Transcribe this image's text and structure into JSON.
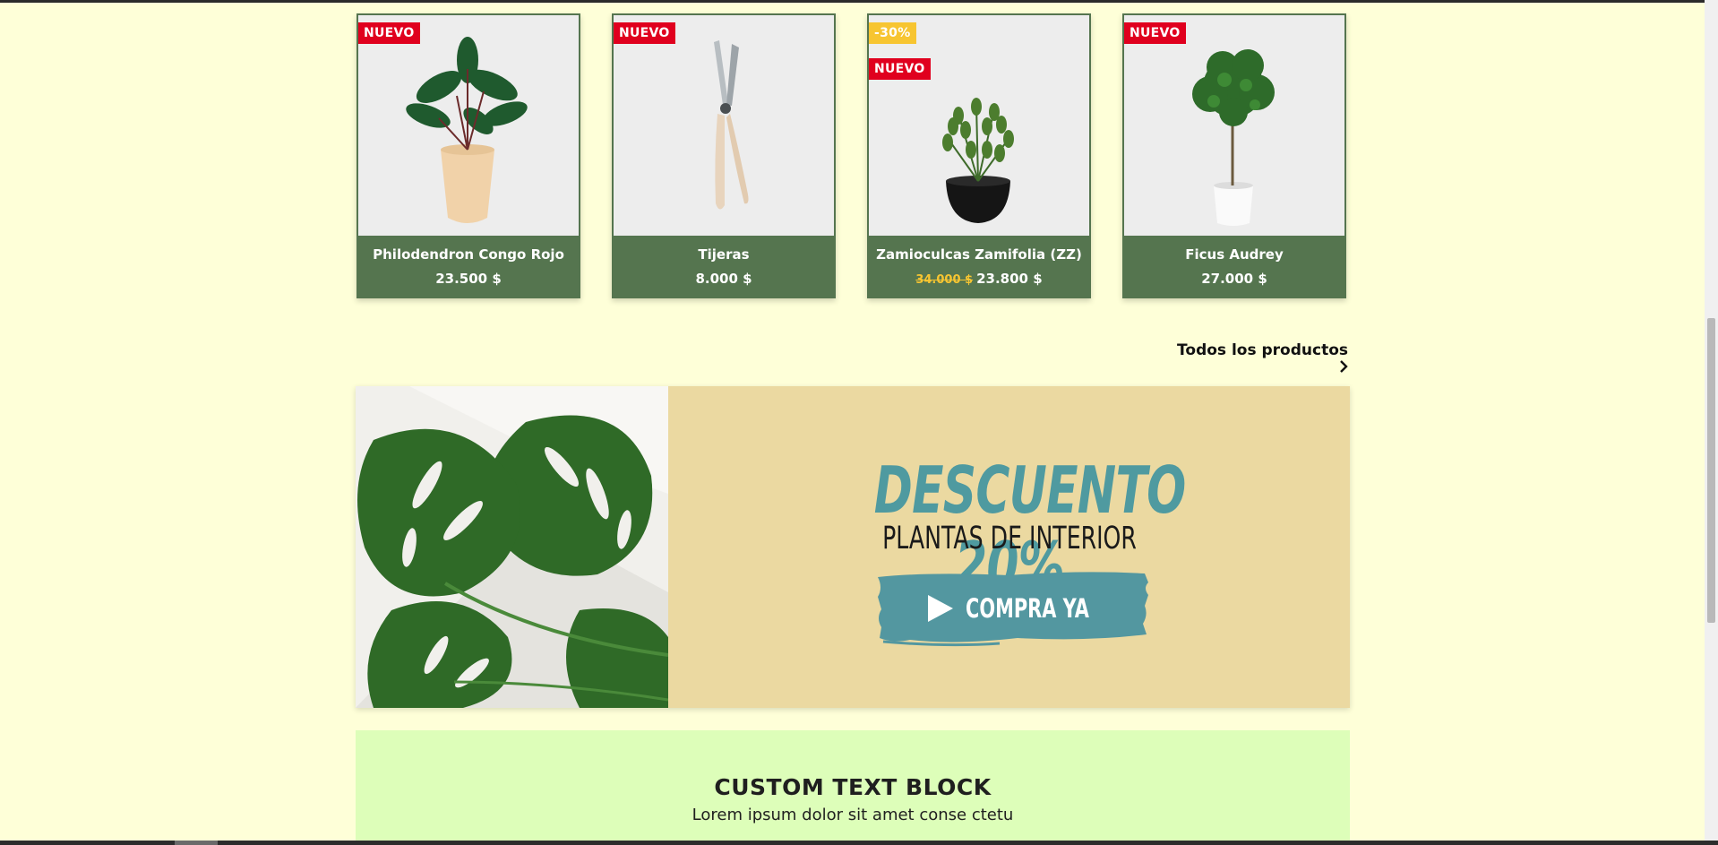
{
  "products": [
    {
      "name": "Philodendron Congo Rojo",
      "price": "23.500 $",
      "badges": [
        "NUEVO"
      ]
    },
    {
      "name": "Tijeras",
      "price": "8.000 $",
      "badges": [
        "NUEVO"
      ]
    },
    {
      "name": "Zamioculcas Zamifolia (ZZ)",
      "old_price": "34.000 $",
      "price": "23.800 $",
      "badges": [
        "-30%",
        "NUEVO"
      ]
    },
    {
      "name": "Ficus Audrey",
      "price": "27.000 $",
      "badges": [
        "NUEVO"
      ]
    }
  ],
  "all_products_link": {
    "label": "Todos los productos",
    "icon": "chevron-right-icon"
  },
  "banner": {
    "title": "DESCUENTO 20%",
    "subtitle": "PLANTAS DE INTERIOR",
    "cta_label": "COMPRA YA",
    "cta_icon": "play-icon",
    "colors": {
      "background": "#EBD9A1",
      "accent": "#4F9AA0"
    }
  },
  "text_block": {
    "title": "CUSTOM TEXT BLOCK",
    "body": "Lorem ipsum dolor sit amet conse ctetu"
  },
  "colors": {
    "page_background": "#FEFFD8",
    "card_footer": "#55754f",
    "badge_new": "#E0001E",
    "badge_discount": "#F7C531",
    "text_block_background": "#DDFEB9"
  }
}
